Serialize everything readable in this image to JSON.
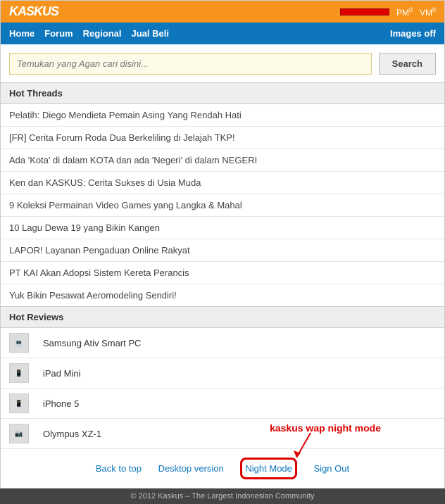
{
  "header": {
    "logo": "KASKUS",
    "pm_label": "PM",
    "pm_count": "0",
    "vm_label": "VM",
    "vm_count": "0"
  },
  "nav": {
    "items": [
      "Home",
      "Forum",
      "Regional",
      "Jual Beli"
    ],
    "images_off": "Images off"
  },
  "search": {
    "placeholder": "Temukan yang Agan cari disini...",
    "button": "Search"
  },
  "hot_threads": {
    "title": "Hot Threads",
    "items": [
      "Pelatih: Diego Mendieta Pemain Asing Yang Rendah Hati",
      "[FR] Cerita Forum Roda Dua Berkeliling di Jelajah TKP!",
      "Ada 'Kota' di dalam KOTA dan ada 'Negeri' di dalam NEGERI",
      "Ken dan KASKUS: Cerita Sukses di Usia Muda",
      "9 Koleksi Permainan Video Games yang Langka & Mahal",
      "10 Lagu Dewa 19 yang Bikin Kangen",
      "LAPOR! Layanan Pengaduan Online Rakyat",
      "PT KAI Akan Adopsi Sistem Kereta Perancis",
      "Yuk Bikin Pesawat Aeromodeling Sendiri!"
    ]
  },
  "hot_reviews": {
    "title": "Hot Reviews",
    "items": [
      {
        "label": "Samsung Ativ Smart PC"
      },
      {
        "label": "iPad Mini"
      },
      {
        "label": "iPhone 5"
      },
      {
        "label": "Olympus XZ-1"
      }
    ]
  },
  "footer": {
    "back_to_top": "Back to top",
    "desktop": "Desktop version",
    "night_mode": "Night Mode",
    "sign_out": "Sign Out",
    "copyright": "© 2012 Kaskus – The Largest Indonesian Community"
  },
  "annotation": {
    "text": "kaskus wap night mode"
  }
}
